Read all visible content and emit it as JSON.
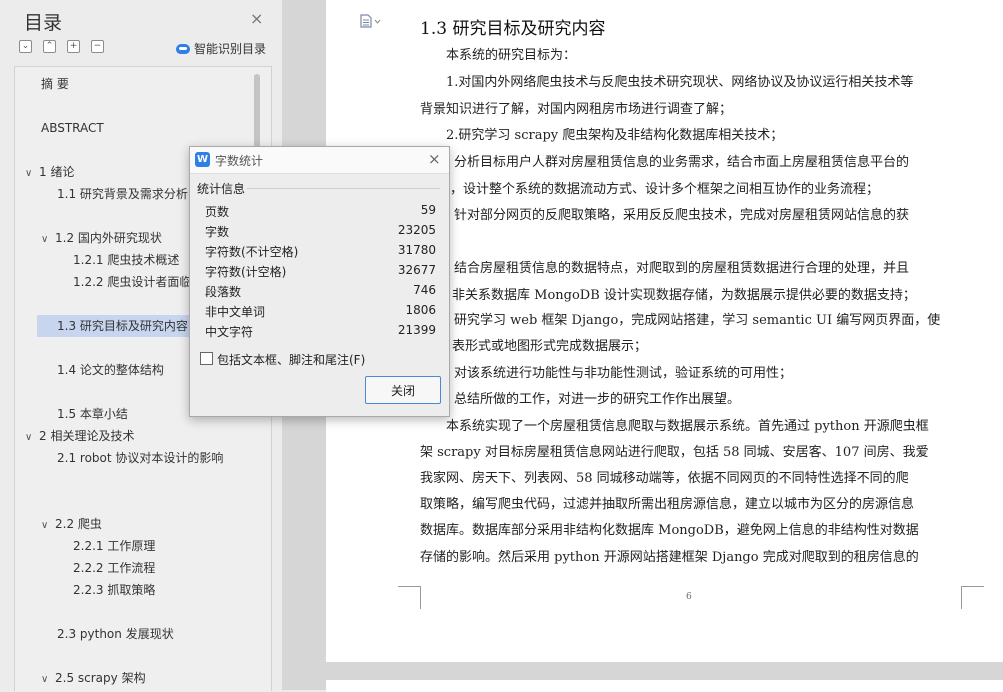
{
  "toc": {
    "title": "目录",
    "close_glyph": "×",
    "toolbar_glyphs": [
      "⌄",
      "⌃",
      "+",
      "−"
    ],
    "smart_toc_label": "智能识别目录",
    "items": [
      {
        "label": "摘  要",
        "chev": ""
      },
      {
        "label": "ABSTRACT",
        "chev": ""
      },
      {
        "label": "1  绪论",
        "chev": "∨"
      },
      {
        "label": "1.1  研究背景及需求分析",
        "chev": ""
      },
      {
        "label": "1.2  国内外研究现状",
        "chev": "∨"
      },
      {
        "label": "1.2.1  爬虫技术概述",
        "chev": ""
      },
      {
        "label": "1.2.2  爬虫设计者面临",
        "chev": ""
      },
      {
        "label": "1.3  研究目标及研究内容",
        "chev": ""
      },
      {
        "label": "1.4  论文的整体结构",
        "chev": ""
      },
      {
        "label": "1.5  本章小结",
        "chev": ""
      },
      {
        "label": "2  相关理论及技术",
        "chev": "∨"
      },
      {
        "label": "2.1 robot 协议对本设计的影响",
        "chev": ""
      },
      {
        "label": "2.2  爬虫",
        "chev": "∨"
      },
      {
        "label": "2.2.1  工作原理",
        "chev": ""
      },
      {
        "label": "2.2.2  工作流程",
        "chev": ""
      },
      {
        "label": "2.2.3  抓取策略",
        "chev": ""
      },
      {
        "label": "2.3 python 发展现状",
        "chev": ""
      },
      {
        "label": "2.5 scrapy 架构",
        "chev": "∨"
      }
    ]
  },
  "document": {
    "heading": "1.3  研究目标及研究内容",
    "page_number": "6",
    "lines": [
      "本系统的研究目标为：",
      "1.对国内外网络爬虫技术与反爬虫技术研究现状、网络协议及协议运行相关技术等",
      "背景知识进行了解，对国内网租房市场进行调查了解；",
      "2.研究学习 scrapy 爬虫架构及非结构化数据库相关技术；",
      "分析目标用户人群对房屋租赁信息的业务需求，结合市面上房屋租赁信息平台的",
      "，设计整个系统的数据流动方式、设计多个框架之间相互协作的业务流程；",
      "针对部分网页的反爬取策略，采用反反爬虫技术，完成对房屋租赁网站信息的获",
      "结合房屋租赁信息的数据特点，对爬取到的房屋租赁数据进行合理的处理，并且",
      "非关系数据库 MongoDB 设计实现数据存储，为数据展示提供必要的数据支持；",
      "研究学习 web 框架 Django，完成网站搭建，学习 semantic UI 编写网页界面，使",
      "表形式或地图形式完成数据展示；",
      "对该系统进行功能性与非功能性测试，验证系统的可用性；",
      "总结所做的工作，对进一步的研究工作作出展望。",
      "本系统实现了一个房屋租赁信息爬取与数据展示系统。首先通过 python 开源爬虫框",
      "架 scrapy 对目标房屋租赁信息网站进行爬取，包括 58 同城、安居客、107 间房、我爱",
      "我家网、房天下、列表网、58 同城移动端等，依据不同网页的不同特性选择不同的爬",
      "取策略，编写爬虫代码，过滤并抽取所需出租房源信息，建立以城市为区分的房源信息",
      "数据库。数据库部分采用非结构化数据库 MongoDB，避免网上信息的非结构性对数据",
      "存储的影响。然后采用 python 开源网站搭建框架 Django 完成对爬取到的租房信息的"
    ]
  },
  "dialog": {
    "logo": "W",
    "title": "字数统计",
    "close_glyph": "×",
    "group_label": "统计信息",
    "stats": [
      {
        "label": "页数",
        "value": "59"
      },
      {
        "label": "字数",
        "value": "23205"
      },
      {
        "label": "字符数(不计空格)",
        "value": "31780"
      },
      {
        "label": "字符数(计空格)",
        "value": "32677"
      },
      {
        "label": "段落数",
        "value": "746"
      },
      {
        "label": "非中文单词",
        "value": "1806"
      },
      {
        "label": "中文字符",
        "value": "21399"
      }
    ],
    "checkbox_label": "包括文本框、脚注和尾注(F)",
    "checkbox_checked": false,
    "close_button_label": "关闭"
  }
}
